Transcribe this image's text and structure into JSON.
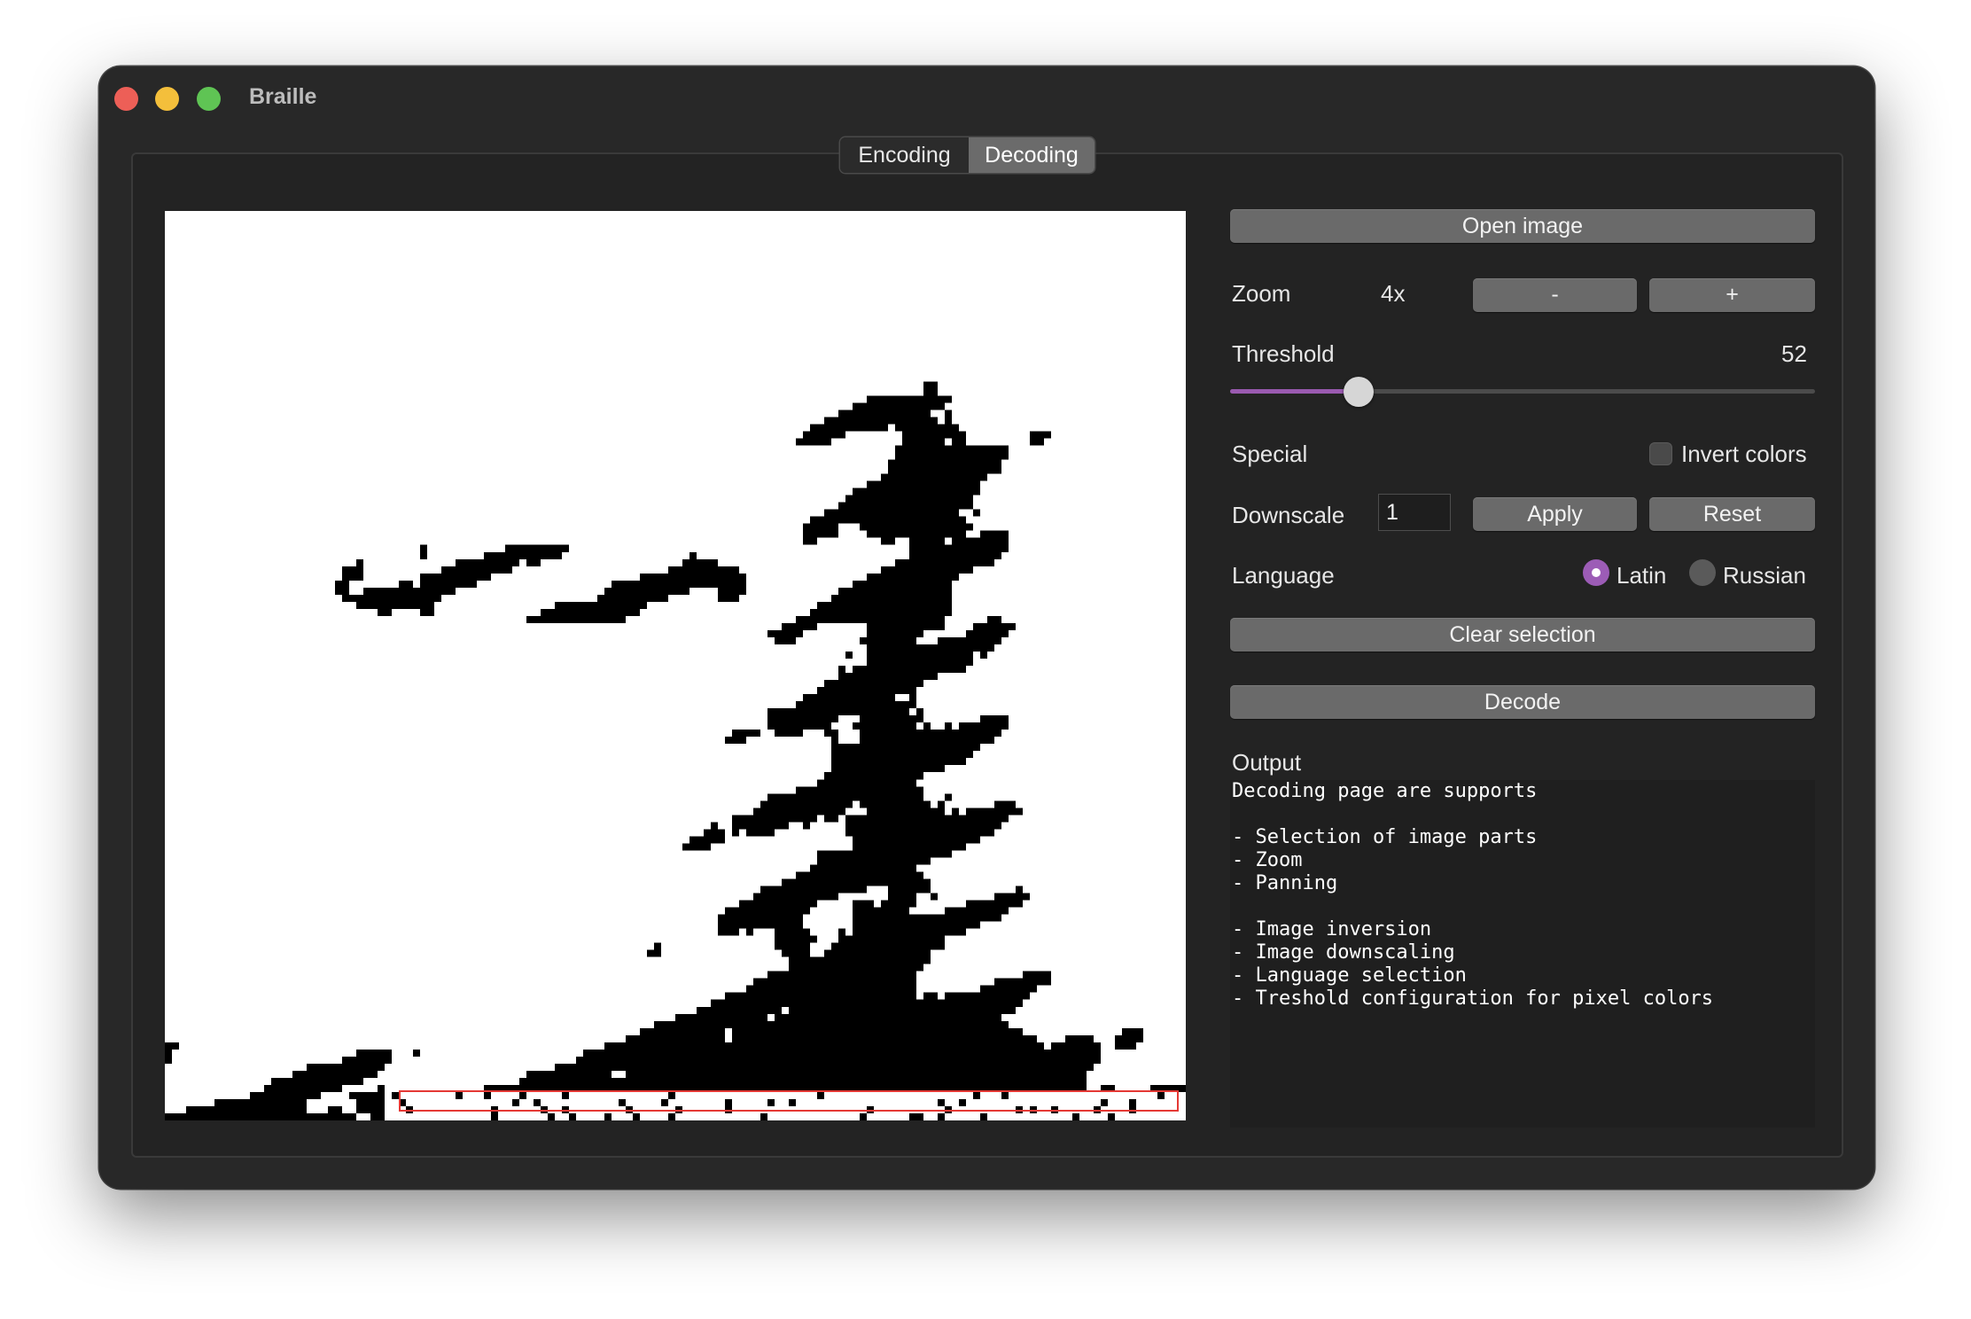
{
  "window": {
    "title": "Braille"
  },
  "tabs": [
    {
      "label": "Encoding",
      "active": false
    },
    {
      "label": "Decoding",
      "active": true
    }
  ],
  "panel": {
    "open_image": "Open image",
    "zoom": {
      "label": "Zoom",
      "value": "4x",
      "minus": "-",
      "plus": "+"
    },
    "threshold": {
      "label": "Threshold",
      "value": "52",
      "fraction": 0.22
    },
    "special": {
      "label": "Special",
      "invert_label": "Invert colors",
      "invert_checked": false
    },
    "downscale": {
      "label": "Downscale",
      "value": "1",
      "apply": "Apply",
      "reset": "Reset"
    },
    "language": {
      "label": "Language",
      "options": [
        "Latin",
        "Russian"
      ],
      "selected": "Latin"
    },
    "clear_selection": "Clear selection",
    "decode": "Decode",
    "output": {
      "label": "Output",
      "lines": [
        "Decoding page are supports",
        "",
        "- Selection of image parts",
        "- Zoom",
        "- Panning",
        "",
        "- Image inversion",
        "- Image downscaling",
        "- Language selection",
        "- Treshold configuration for pixel colors"
      ]
    }
  },
  "colors": {
    "window_bg": "#282828",
    "accent": "#9c5cb6",
    "button": "#6a6a6a",
    "selection": "#e53935"
  }
}
